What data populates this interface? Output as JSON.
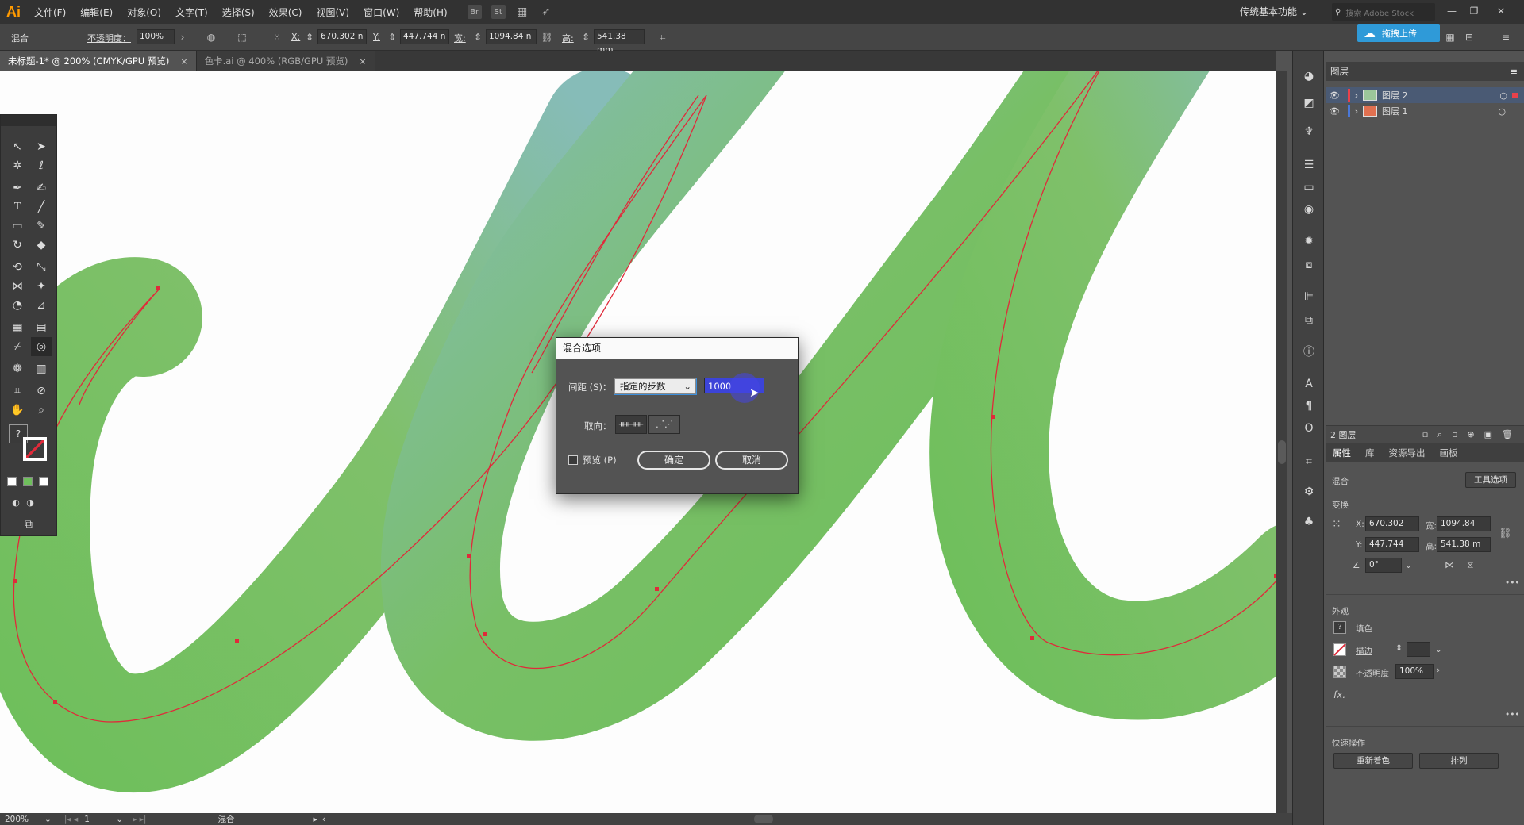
{
  "app": {
    "logo": "Ai"
  },
  "menu": [
    "文件(F)",
    "编辑(E)",
    "对象(O)",
    "文字(T)",
    "选择(S)",
    "效果(C)",
    "视图(V)",
    "窗口(W)",
    "帮助(H)"
  ],
  "menubar_icons": {
    "bridge": "Br",
    "stock": "St"
  },
  "workspace": "传统基本功能",
  "search_placeholder": "搜索 Adobe Stock",
  "cloud_upload": "拖拽上传",
  "control": {
    "mode": "混合",
    "opacity_label": "不透明度：",
    "opacity_value": "100%",
    "x_label": "X:",
    "x_value": "670.302 n",
    "y_label": "Y:",
    "y_value": "447.744 n",
    "w_label": "宽:",
    "w_value": "1094.84 n",
    "h_label": "高:",
    "h_value": "541.38 mm"
  },
  "tabs": [
    {
      "label": "未标题-1* @ 200% (CMYK/GPU 预览)",
      "close": "×"
    },
    {
      "label": "色卡.ai @ 400% (RGB/GPU 预览)",
      "close": "×"
    }
  ],
  "layers": {
    "title": "图层",
    "rows": [
      {
        "name": "图层 2",
        "color": "#e8414b"
      },
      {
        "name": "图层 1",
        "color": "#4a78d8"
      }
    ],
    "count": "2 图层"
  },
  "props": {
    "tabs": [
      "属性",
      "库",
      "资源导出",
      "画板"
    ],
    "selection_label": "混合",
    "tool_options": "工具选项",
    "transform_label": "变换",
    "x_label": "X:",
    "x_value": "670.302",
    "y_label": "Y:",
    "y_value": "447.744",
    "w_label": "宽:",
    "w_value": "1094.84",
    "h_label": "高:",
    "h_value": "541.38 m",
    "angle": "0°",
    "appearance_label": "外观",
    "fill_label": "填色",
    "stroke_label": "描边",
    "opacity_label": "不透明度",
    "opacity_value": "100%",
    "fx": "fx.",
    "quick_label": "快速操作",
    "recolor": "重新着色",
    "arrange": "排列"
  },
  "dialog": {
    "title": "混合选项",
    "spacing_label": "间距 (S)：",
    "spacing_value": "指定的步数",
    "steps_value": "1000",
    "orientation_label": "取向：",
    "preview_label": "预览 (P)",
    "ok": "确定",
    "cancel": "取消"
  },
  "status": {
    "zoom": "200%",
    "artboard": "1",
    "tool": "混合"
  },
  "colors": {
    "accent": "#3c44d8",
    "blend_green": "#6fbf5c",
    "blend_teal": "#88bcc0",
    "path_red": "#e02a3a"
  }
}
